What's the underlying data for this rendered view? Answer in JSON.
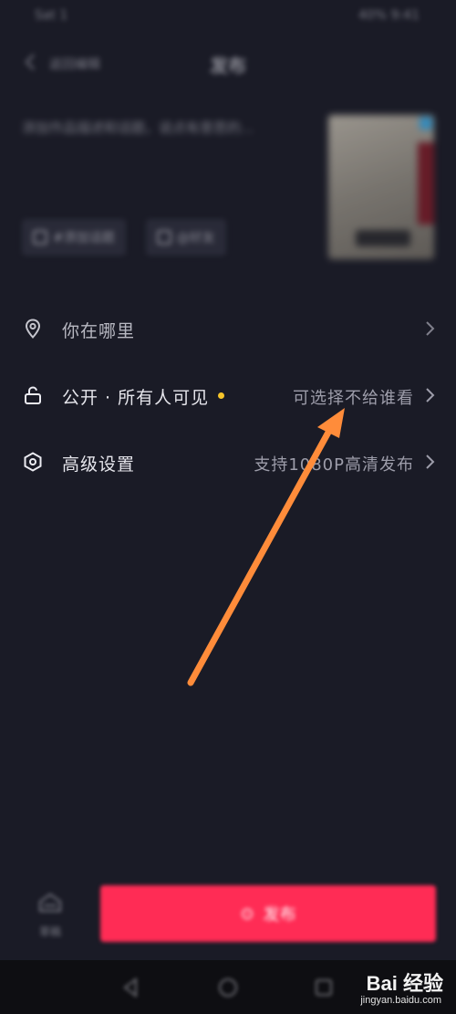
{
  "status_bar": {
    "left": "Sat 1",
    "right": "40% 9:41"
  },
  "topbar": {
    "back_label": "返回编辑",
    "title": "发布"
  },
  "caption": {
    "text": "添加作品描述和话题，说点有意思的..."
  },
  "chips": [
    {
      "label": "#添加话题"
    },
    {
      "label": "@好友"
    }
  ],
  "settings": {
    "location": {
      "label": "你在哪里"
    },
    "privacy": {
      "label": "公开 · 所有人可见",
      "value": "可选择不给谁看",
      "dot_color": "#f7c52a"
    },
    "advanced": {
      "label": "高级设置",
      "value": "支持1080P高清发布"
    }
  },
  "bottom": {
    "draft_label": "草稿",
    "publish_label": "发布"
  },
  "annotation": {
    "arrow_color": "#ff8c3a"
  },
  "watermark": {
    "logo": "Bai 经验",
    "url": "jingyan.baidu.com"
  }
}
